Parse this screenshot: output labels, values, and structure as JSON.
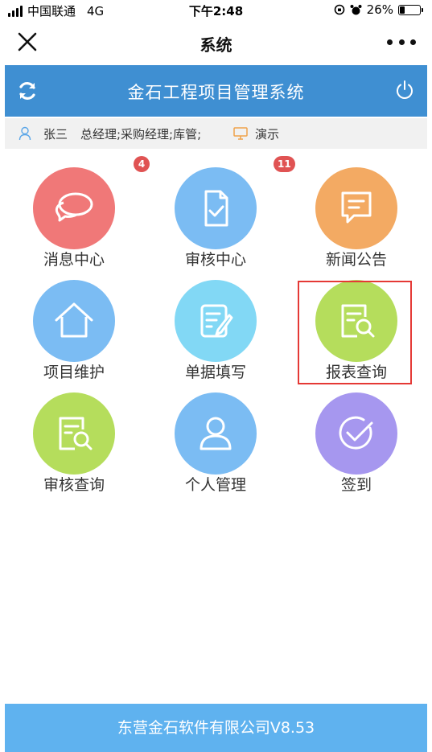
{
  "status_bar": {
    "carrier": "中国联通",
    "network": "4G",
    "time": "下午2:48",
    "battery": "26%",
    "battery_level": 0.26
  },
  "nav": {
    "title": "系统"
  },
  "app": {
    "title": "金石工程项目管理系统"
  },
  "user": {
    "name": "张三",
    "roles": "总经理;采购经理;库管;",
    "mode": "演示"
  },
  "menu": [
    {
      "label": "消息中心",
      "badge": "4",
      "color": "#f07878",
      "icon": "chat-bubbles-icon"
    },
    {
      "label": "审核中心",
      "badge": "11",
      "color": "#7bbcf3",
      "icon": "doc-check-icon"
    },
    {
      "label": "新闻公告",
      "badge": "",
      "color": "#f3aa63",
      "icon": "message-icon"
    },
    {
      "label": "项目维护",
      "badge": "",
      "color": "#7bbcf3",
      "icon": "home-icon"
    },
    {
      "label": "单据填写",
      "badge": "",
      "color": "#82d8f5",
      "icon": "edit-doc-icon"
    },
    {
      "label": "报表查询",
      "badge": "",
      "color": "#b5dd5c",
      "icon": "doc-search-icon"
    },
    {
      "label": "审核查询",
      "badge": "",
      "color": "#b5dd5c",
      "icon": "doc-search-icon"
    },
    {
      "label": "个人管理",
      "badge": "",
      "color": "#7bbcf3",
      "icon": "person-icon"
    },
    {
      "label": "签到",
      "badge": "",
      "color": "#a697ef",
      "icon": "check-circle-icon"
    }
  ],
  "footer": {
    "text": "东营金石软件有限公司V8.53"
  }
}
